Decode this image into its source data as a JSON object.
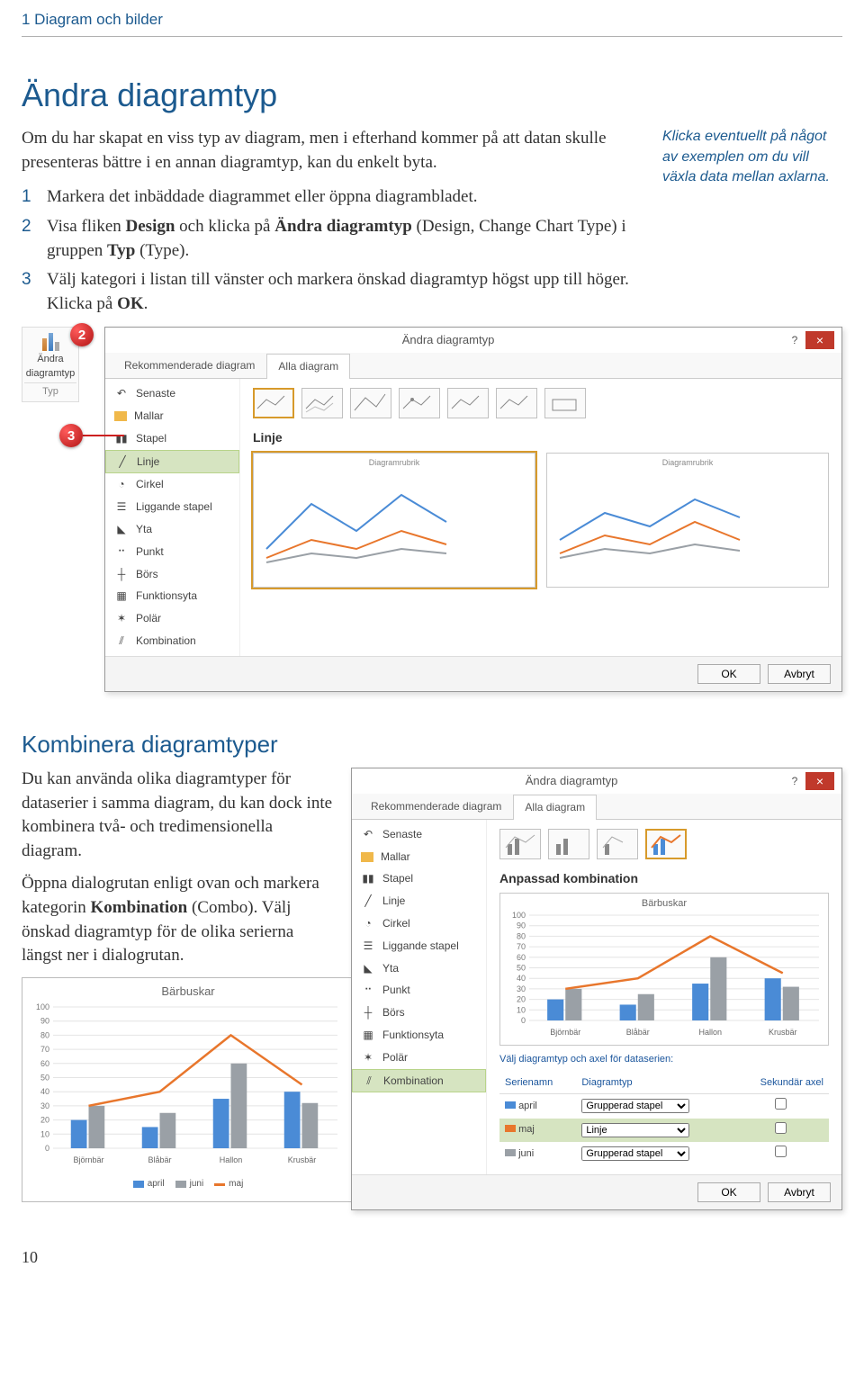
{
  "header": "1  Diagram och bilder",
  "h1": "Ändra diagramtyp",
  "intro": "Om du har skapat en viss typ av diagram, men i efterhand kommer på att datan skulle presenteras bättre i en annan diagramtyp, kan du enkelt byta.",
  "steps": [
    "Markera det inbäddade diagrammet eller öppna diagrambladet.",
    "Visa fliken Design och klicka på Ändra diagramtyp (Design, Change Chart Type) i gruppen Typ (Type).",
    "Välj kategori i listan till vänster och markera önskad diagramtyp högst upp till höger. Klicka på OK."
  ],
  "sidenote": "Klicka eventuellt på något av exemplen om du vill växla data mellan axlarna.",
  "ribbon": {
    "label1": "Ändra",
    "label2": "diagramtyp",
    "group": "Typ"
  },
  "dialog1": {
    "title": "Ändra diagramtyp",
    "tabs": [
      "Rekommenderade diagram",
      "Alla diagram"
    ],
    "activeTab": 1,
    "cats": [
      "Senaste",
      "Mallar",
      "Stapel",
      "Linje",
      "Cirkel",
      "Liggande stapel",
      "Yta",
      "Punkt",
      "Börs",
      "Funktionsyta",
      "Polär",
      "Kombination"
    ],
    "catSelected": "Linje",
    "paneTitle": "Linje",
    "prevTitle": "Diagramrubrik",
    "ok": "OK",
    "cancel": "Avbryt"
  },
  "h2": "Kombinera diagramtyper",
  "combo_p1": "Du kan använda olika diagramtyper för dataserier i samma diagram, du kan dock inte kombinera två- och tredimensionella diagram.",
  "combo_p2": "Öppna dialogrutan enligt ovan och markera kategorin Kombination (Combo). Välj önskad diagramtyp för de olika serierna längst ner i dialogrutan.",
  "dialog2": {
    "title": "Ändra diagramtyp",
    "tabs": [
      "Rekommenderade diagram",
      "Alla diagram"
    ],
    "activeTab": 1,
    "cats": [
      "Senaste",
      "Mallar",
      "Stapel",
      "Linje",
      "Cirkel",
      "Liggande stapel",
      "Yta",
      "Punkt",
      "Börs",
      "Funktionsyta",
      "Polär",
      "Kombination"
    ],
    "catSelected": "Kombination",
    "paneTitle": "Anpassad kombination",
    "chartTitle": "Bärbuskar",
    "selectHeader": "Välj diagramtyp och axel för dataserien:",
    "th1": "Serienamn",
    "th2": "Diagramtyp",
    "th3": "Sekundär axel",
    "rows": [
      {
        "name": "april",
        "type": "Grupperad stapel",
        "sec": false,
        "color": "#4a8bd6"
      },
      {
        "name": "maj",
        "type": "Linje",
        "sec": false,
        "color": "#e8762c"
      },
      {
        "name": "juni",
        "type": "Grupperad stapel",
        "sec": false,
        "color": "#9aa0a6"
      }
    ],
    "ok": "OK",
    "cancel": "Avbryt"
  },
  "chart_data": {
    "type": "bar",
    "title": "Bärbuskar",
    "categories": [
      "Björnbär",
      "Blåbär",
      "Hallon",
      "Krusbär"
    ],
    "ylim": [
      0,
      100
    ],
    "yticks": [
      0,
      10,
      20,
      30,
      40,
      50,
      60,
      70,
      80,
      90,
      100
    ],
    "series": [
      {
        "name": "april",
        "type": "bar",
        "color": "#4a8bd6",
        "values": [
          20,
          15,
          35,
          40
        ]
      },
      {
        "name": "juni",
        "type": "bar",
        "color": "#9aa0a6",
        "values": [
          30,
          25,
          60,
          32
        ]
      },
      {
        "name": "maj",
        "type": "line",
        "color": "#e8762c",
        "values": [
          30,
          40,
          80,
          45
        ]
      }
    ],
    "legend": [
      "april",
      "juni",
      "maj"
    ]
  },
  "page_number": "10"
}
